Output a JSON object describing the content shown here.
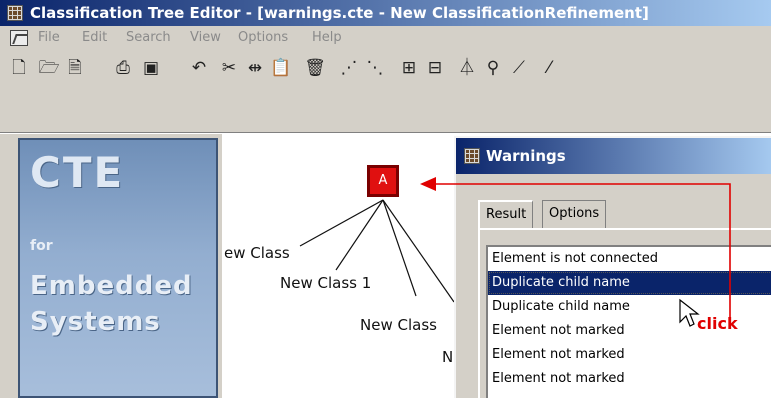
{
  "window": {
    "title": "Classification Tree Editor - [warnings.cte - New ClassificationRefinement]"
  },
  "menu": {
    "items": [
      "File",
      "Edit",
      "Search",
      "View",
      "Options",
      "Help"
    ]
  },
  "toolbar": {
    "buttons": [
      {
        "name": "new-document-icon",
        "glyph": "🗋"
      },
      {
        "name": "open-icon",
        "glyph": "🗁"
      },
      {
        "name": "save-icon",
        "glyph": "🗎"
      },
      {
        "name": "print-icon",
        "glyph": "⎙"
      },
      {
        "name": "preview-icon",
        "glyph": "▣"
      },
      {
        "name": "undo-icon",
        "glyph": "↶"
      },
      {
        "name": "cut-icon",
        "glyph": "✂"
      },
      {
        "name": "move-icon",
        "glyph": "⇹"
      },
      {
        "name": "paste-icon",
        "glyph": "📋"
      },
      {
        "name": "delete-icon",
        "glyph": "🗑"
      },
      {
        "name": "tree-layout-icon",
        "glyph": "⋰"
      },
      {
        "name": "tree-layout-alt-icon",
        "glyph": "⋱"
      },
      {
        "name": "grid-icon",
        "glyph": "⊞"
      },
      {
        "name": "grid-alt-icon",
        "glyph": "⊟"
      },
      {
        "name": "classification-icon",
        "glyph": "⏃"
      },
      {
        "name": "branch-icon",
        "glyph": "⚲"
      },
      {
        "name": "refine-icon",
        "glyph": "⟋"
      },
      {
        "name": "marker-icon",
        "glyph": "⁄"
      }
    ]
  },
  "branding": {
    "logo": "CTE",
    "for": "for",
    "line1": "Embedded",
    "line2": "Systems"
  },
  "tree": {
    "root_label": "A",
    "nodes": [
      "ew Class",
      "New Class 1",
      "New Class",
      "N"
    ]
  },
  "dialog": {
    "title": "Warnings",
    "tabs": [
      "Result",
      "Options"
    ],
    "items": [
      "Element is not connected",
      "Duplicate child name",
      "Duplicate child name",
      "Element not marked",
      "Element not marked",
      "Element not marked"
    ],
    "selected_index": 1
  },
  "annotation": {
    "label": "click",
    "color": "#e00000"
  }
}
